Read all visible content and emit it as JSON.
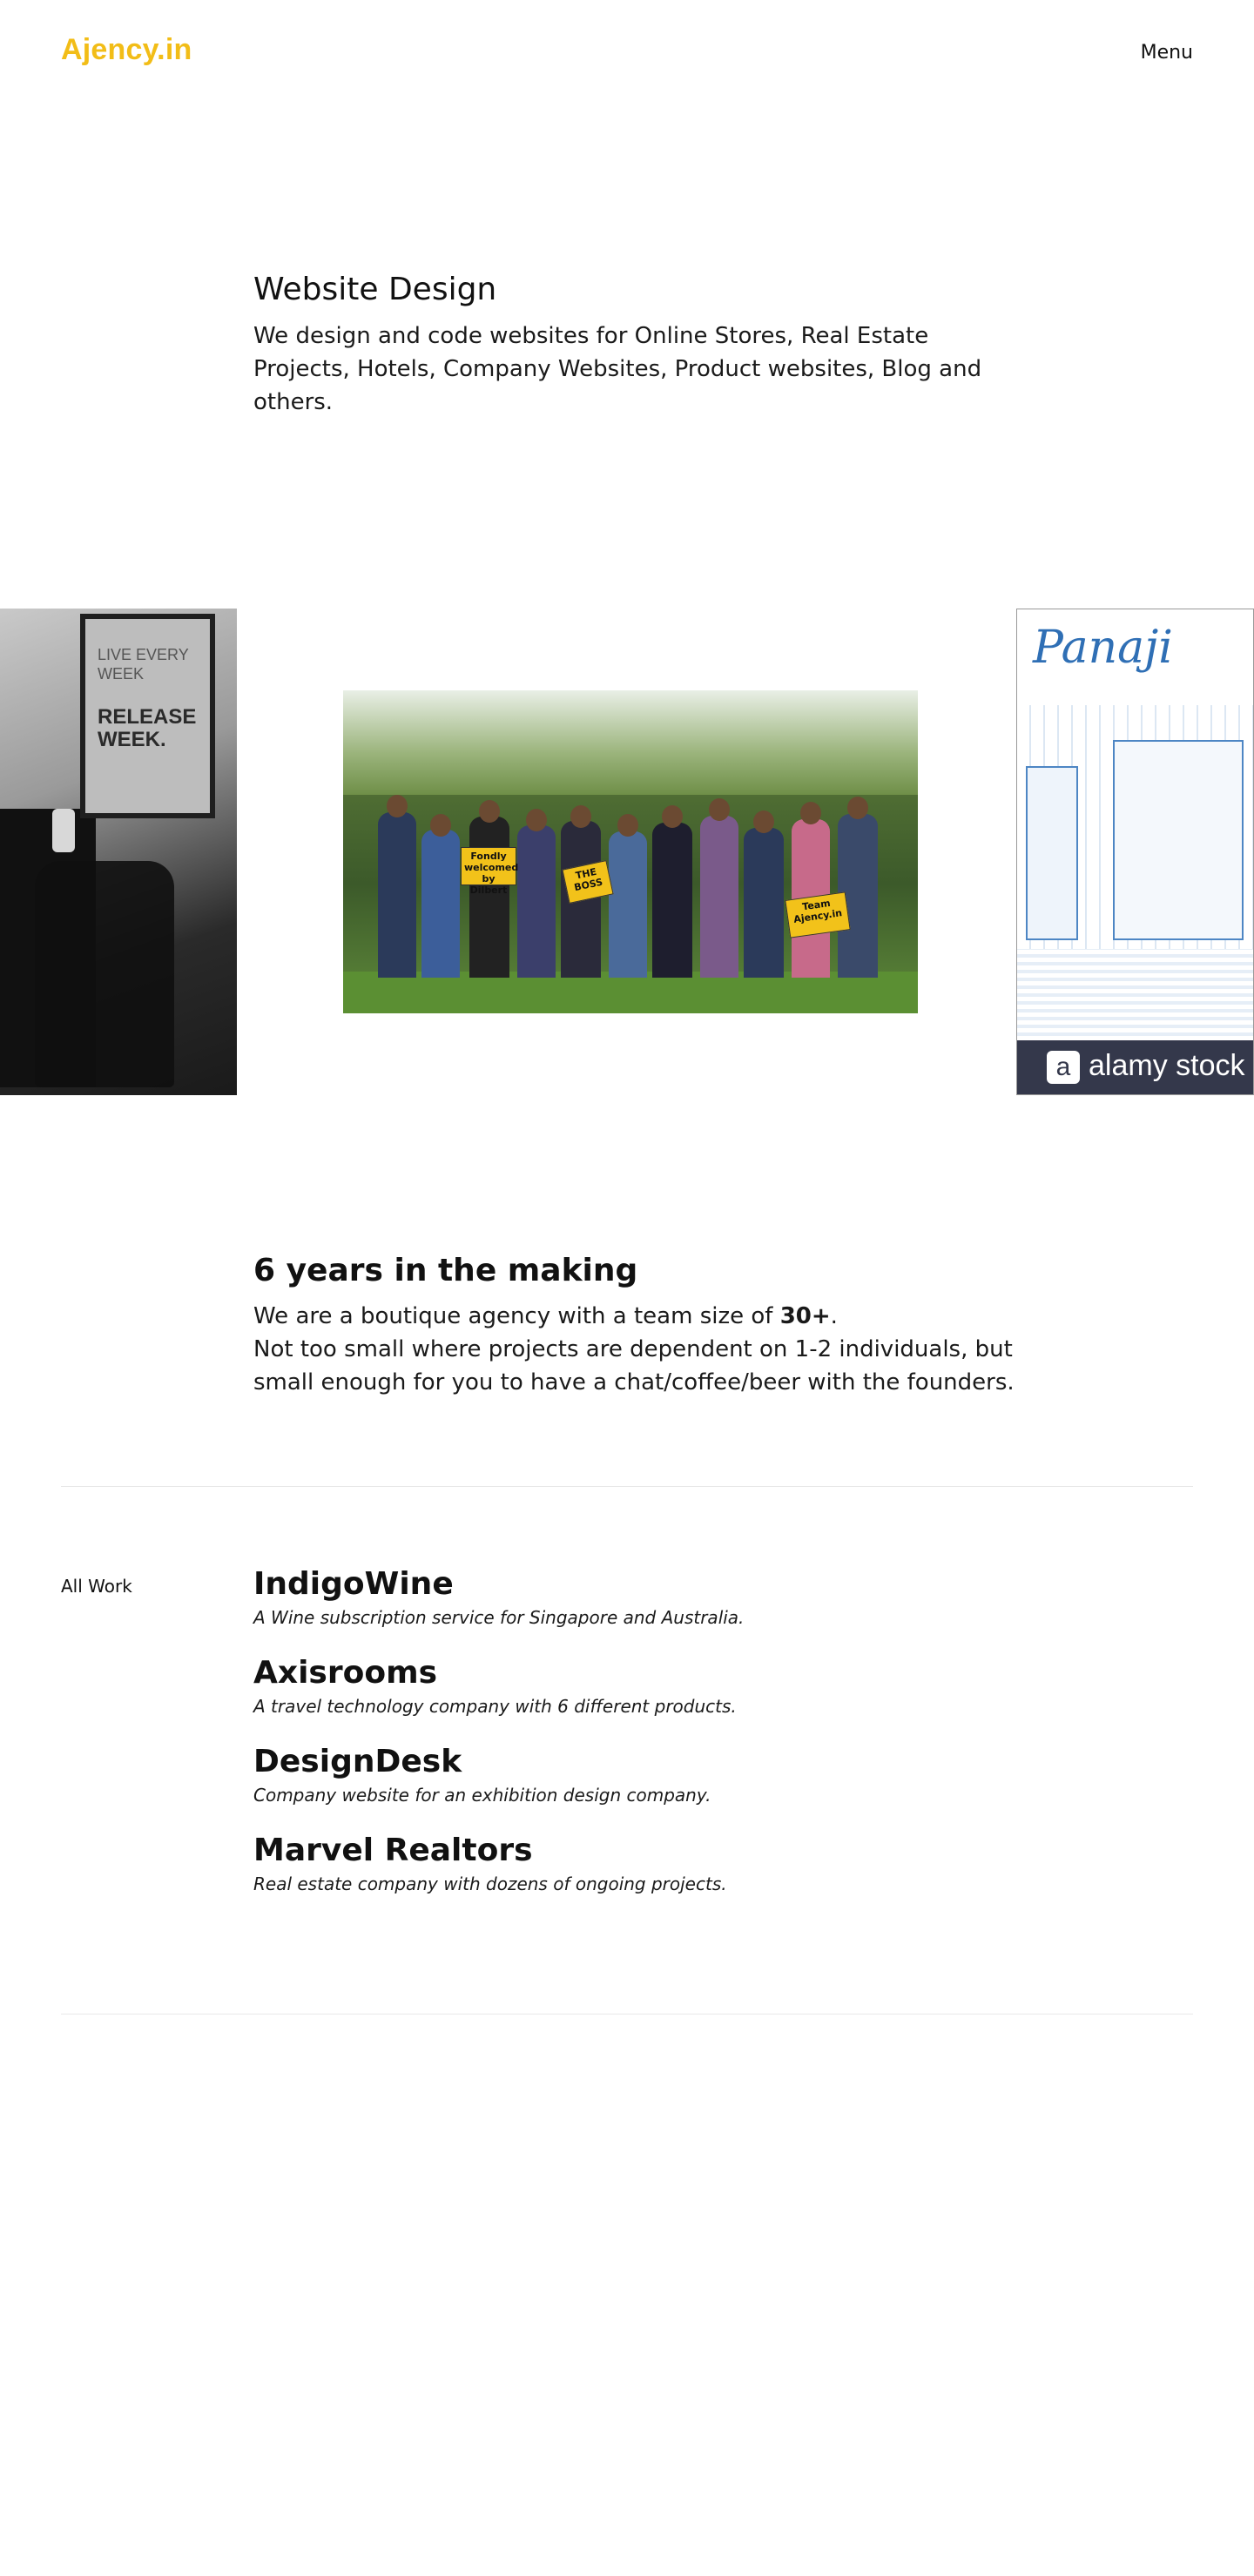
{
  "header": {
    "logo": "Ajency.in",
    "menu_label": "Menu"
  },
  "intro": {
    "heading": "Website Design",
    "body": "We design and code websites for Online Stores, Real Estate Projects, Hotels, Company Websites, Product websites, Blog and others."
  },
  "carousel": {
    "left_poster_line1": "LIVE EVERY WEEK",
    "left_poster_line2": "RELEASE WEEK.",
    "center_signs": [
      "Fondly welcomed by Dilbert",
      "THE BOSS",
      "Team Ajency.in"
    ],
    "right_title": "Panaji",
    "right_watermark": "alamy stock",
    "right_watermark_glyph": "a"
  },
  "about": {
    "heading": "6 years in the making",
    "line1_prefix": "We are a boutique agency with a team size of ",
    "team_size": "30+",
    "line1_suffix": ".",
    "line2": "Not too small where projects are dependent on 1-2 individuals, but small enough for you to have a chat/coffee/beer with the founders."
  },
  "work": {
    "label": "All Work",
    "items": [
      {
        "title": "IndigoWine",
        "desc": "A Wine subscription service for Singapore and Australia."
      },
      {
        "title": "Axisrooms",
        "desc": "A travel technology company with 6 different products."
      },
      {
        "title": "DesignDesk",
        "desc": "Company website for an exhibition design company."
      },
      {
        "title": "Marvel Realtors",
        "desc": "Real estate company with dozens of ongoing projects."
      }
    ]
  },
  "colors": {
    "brand": "#f2bd17",
    "text": "#111111",
    "divider": "#e8e8e8"
  }
}
